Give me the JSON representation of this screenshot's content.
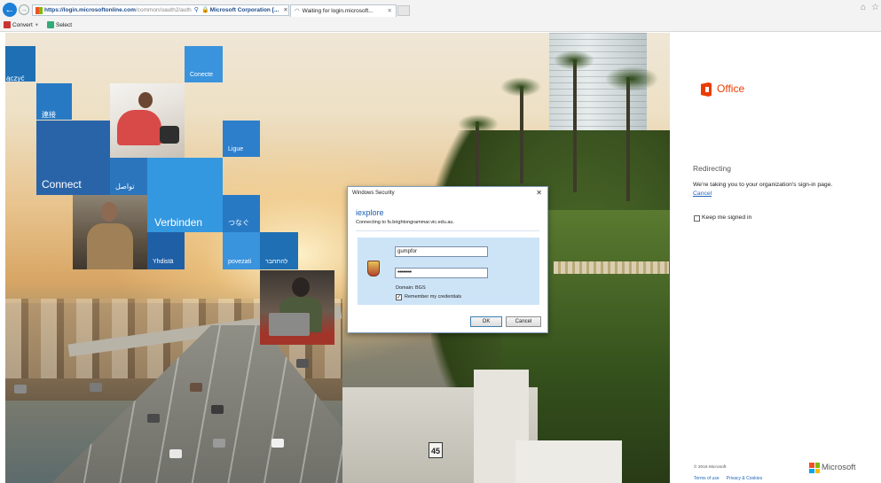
{
  "browser": {
    "url_highlight": "https://login.microsoftonline.com",
    "url_rest": "/common/oauth2/auth",
    "cert_label": "Microsoft Corporation [...",
    "tab_title": "Waiting for login.microsoft...",
    "command_bar": {
      "convert_label": "Convert",
      "select_label": "Select"
    }
  },
  "tiles": [
    {
      "key": "laczyc",
      "text": "ączyć"
    },
    {
      "key": "conecte",
      "text": "Conecte"
    },
    {
      "key": "lianjie",
      "text": "連接"
    },
    {
      "key": "ligue",
      "text": "Ligue"
    },
    {
      "key": "connect",
      "text": "Connect"
    },
    {
      "key": "tawasul",
      "text": "تواصل"
    },
    {
      "key": "verbinden",
      "text": "Verbinden"
    },
    {
      "key": "tsunagu",
      "text": "つなぐ"
    },
    {
      "key": "yhdista",
      "text": "Yhdistä"
    },
    {
      "key": "povezati",
      "text": "povezati"
    },
    {
      "key": "hithaber",
      "text": "להתחבר"
    }
  ],
  "background": {
    "road_sign": "45"
  },
  "dialog": {
    "title": "Windows Security",
    "app_name": "iexplore",
    "connecting_text": "Connecting to fs.brightongrammar.vic.edu.au.",
    "username_value": "gumpfor",
    "password_mask": "••••••••",
    "domain_text": "Domain: BGS",
    "remember_label": "Remember my credentials",
    "remember_checked": "✓",
    "ok_label": "OK",
    "cancel_label": "Cancel"
  },
  "signin_panel": {
    "office_label": "Office",
    "redirect_title": "Redirecting",
    "redirect_message": "We're taking you to your organization's sign-in page.",
    "cancel_link": "Cancel",
    "keep_signed_in_label": "Keep me signed in",
    "copyright": "© 2016 Microsoft",
    "terms_link": "Terms of use",
    "privacy_link": "Privacy & Cookies",
    "microsoft_label": "Microsoft"
  },
  "colors": {
    "office_orange": "#eb3c00",
    "link_blue": "#2266bb",
    "ms_red": "#f25022",
    "ms_green": "#7fba00",
    "ms_blue": "#00a4ef",
    "ms_yellow": "#ffb900"
  },
  "icons": [
    "back-arrow-icon",
    "forward-arrow-icon",
    "search-icon",
    "lock-icon",
    "loading-spinner-icon",
    "home-icon",
    "favorites-star-icon",
    "close-icon",
    "credential-shield-icon",
    "office-logo-icon",
    "microsoft-logo-icon"
  ]
}
